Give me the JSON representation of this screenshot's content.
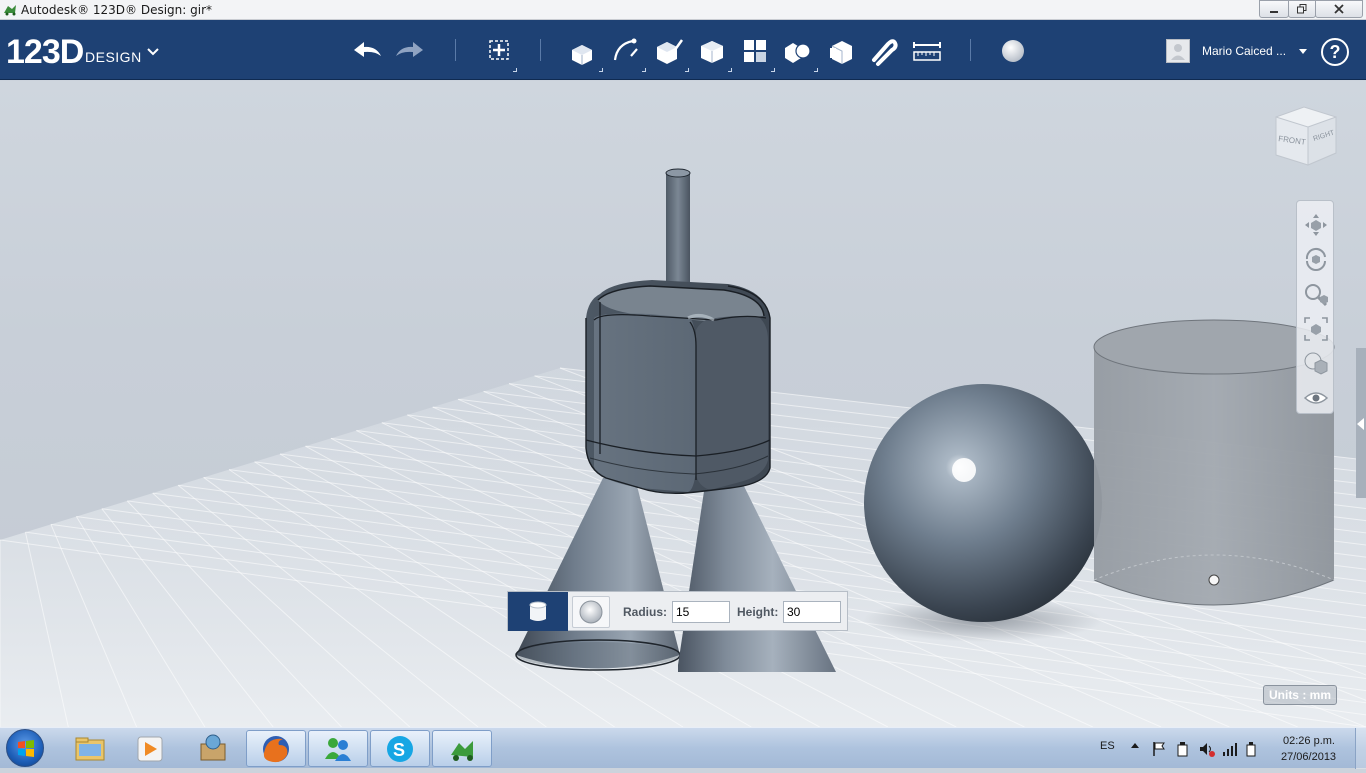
{
  "window": {
    "title": "Autodesk® 123D® Design: gir*"
  },
  "header": {
    "logo_main": "123D",
    "logo_sub": "DESIGN",
    "user_name": "Mario Caiced ...",
    "help_label": "?"
  },
  "toolbar_icons": [
    "undo-icon",
    "redo-icon",
    "transform-icon",
    "primitives-icon",
    "sketch-icon",
    "construct-icon",
    "modify-icon",
    "pattern-icon",
    "grouping-icon",
    "combine-icon",
    "snap-icon",
    "measure-icon",
    "material-icon"
  ],
  "viewcube": {
    "front_label": "FRONT",
    "right_label": "RIGHT"
  },
  "navbar_icons": [
    "pan-icon",
    "orbit-icon",
    "zoom-icon",
    "fit-icon",
    "view-mode-icon",
    "visibility-icon"
  ],
  "status": {
    "units": "Units : mm"
  },
  "primitive_panel": {
    "radius_label": "Radius:",
    "radius_value": "15",
    "height_label": "Height:",
    "height_value": "30"
  },
  "taskbar": {
    "apps": [
      "explorer-icon",
      "media-player-icon",
      "archive-icon",
      "firefox-icon",
      "messenger-icon",
      "skype-icon",
      "123d-design-icon"
    ],
    "language": "ES",
    "time": "02:26 p.m.",
    "date": "27/06/2013"
  },
  "colors": {
    "toolbar_bg": "#1e4174",
    "viewport_bg": "#c8cfd8",
    "model_grey": "#6d7986"
  }
}
